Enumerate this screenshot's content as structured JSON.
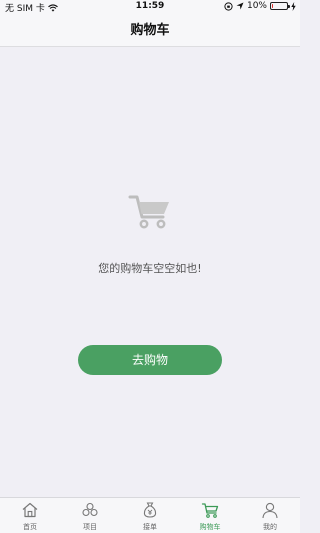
{
  "status_bar": {
    "carrier": "无 SIM 卡",
    "time": "11:59",
    "battery": "10%",
    "battery_level": 0.1,
    "battery_color": "#e0312e"
  },
  "nav": {
    "title": "购物车"
  },
  "empty_state": {
    "message": "您的购物车空空如也!",
    "button_label": "去购物",
    "icon": "cart-icon"
  },
  "colors": {
    "accent": "#4aa062",
    "background": "#f0eff5"
  },
  "tabs": [
    {
      "label": "首页",
      "icon": "home-icon",
      "active": false
    },
    {
      "label": "项目",
      "icon": "coins-icon",
      "active": false
    },
    {
      "label": "接单",
      "icon": "money-bag-icon",
      "active": false
    },
    {
      "label": "购物车",
      "icon": "cart-icon",
      "active": true
    },
    {
      "label": "我的",
      "icon": "user-icon",
      "active": false
    }
  ]
}
